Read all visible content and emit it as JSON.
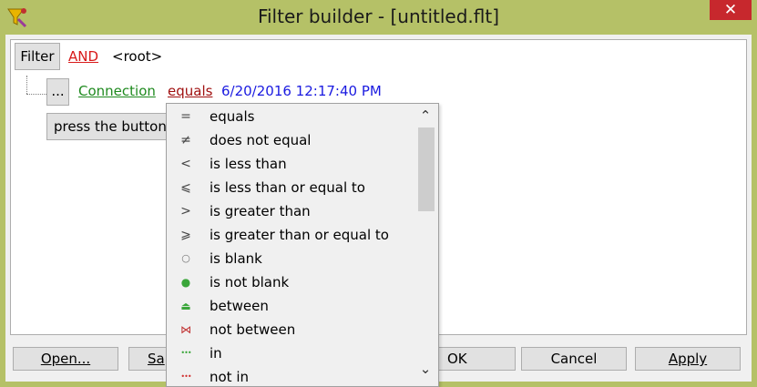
{
  "window": {
    "title": "Filter builder - [untitled.flt]",
    "close_glyph": "✕"
  },
  "filter": {
    "filter_button": "Filter",
    "operator": "AND",
    "root_label": "<root>",
    "ellipsis_button": "...",
    "field": "Connection",
    "condition": "equals",
    "value": "6/20/2016 12:17:40 PM",
    "add_hint": "press the button"
  },
  "buttons": {
    "open": "Open...",
    "save": "Sa",
    "ok": "OK",
    "cancel": "Cancel",
    "apply": "Apply"
  },
  "dropdown": {
    "items": [
      {
        "symbol": "=",
        "label": "equals",
        "icon": "equals-icon"
      },
      {
        "symbol": "≠",
        "label": "does not equal",
        "icon": "not-equal-icon"
      },
      {
        "symbol": "<",
        "label": "is less than",
        "icon": "less-than-icon"
      },
      {
        "symbol": "⩽",
        "label": "is less than or equal to",
        "icon": "less-equal-icon"
      },
      {
        "symbol": ">",
        "label": "is greater than",
        "icon": "greater-than-icon"
      },
      {
        "symbol": "⩾",
        "label": "is greater than or equal to",
        "icon": "greater-equal-icon"
      },
      {
        "symbol": "○",
        "label": "is blank",
        "icon": "blank-circle-icon"
      },
      {
        "symbol": "●",
        "label": "is not blank",
        "icon": "filled-circle-icon"
      },
      {
        "symbol": "⏏",
        "label": "between",
        "icon": "between-icon"
      },
      {
        "symbol": "⋈",
        "label": "not between",
        "icon": "not-between-icon"
      },
      {
        "symbol": "•••",
        "label": "in",
        "icon": "in-icon"
      },
      {
        "symbol": "•••",
        "label": "not in",
        "icon": "not-in-icon"
      }
    ],
    "scroll_up": "⌃",
    "scroll_down": "⌄"
  },
  "colors": {
    "title_bar": "#b5c167",
    "close_button": "#c7282d",
    "operator_red": "#d81a1a",
    "field_green": "#1f8a1f",
    "value_blue": "#1a1ae0"
  }
}
